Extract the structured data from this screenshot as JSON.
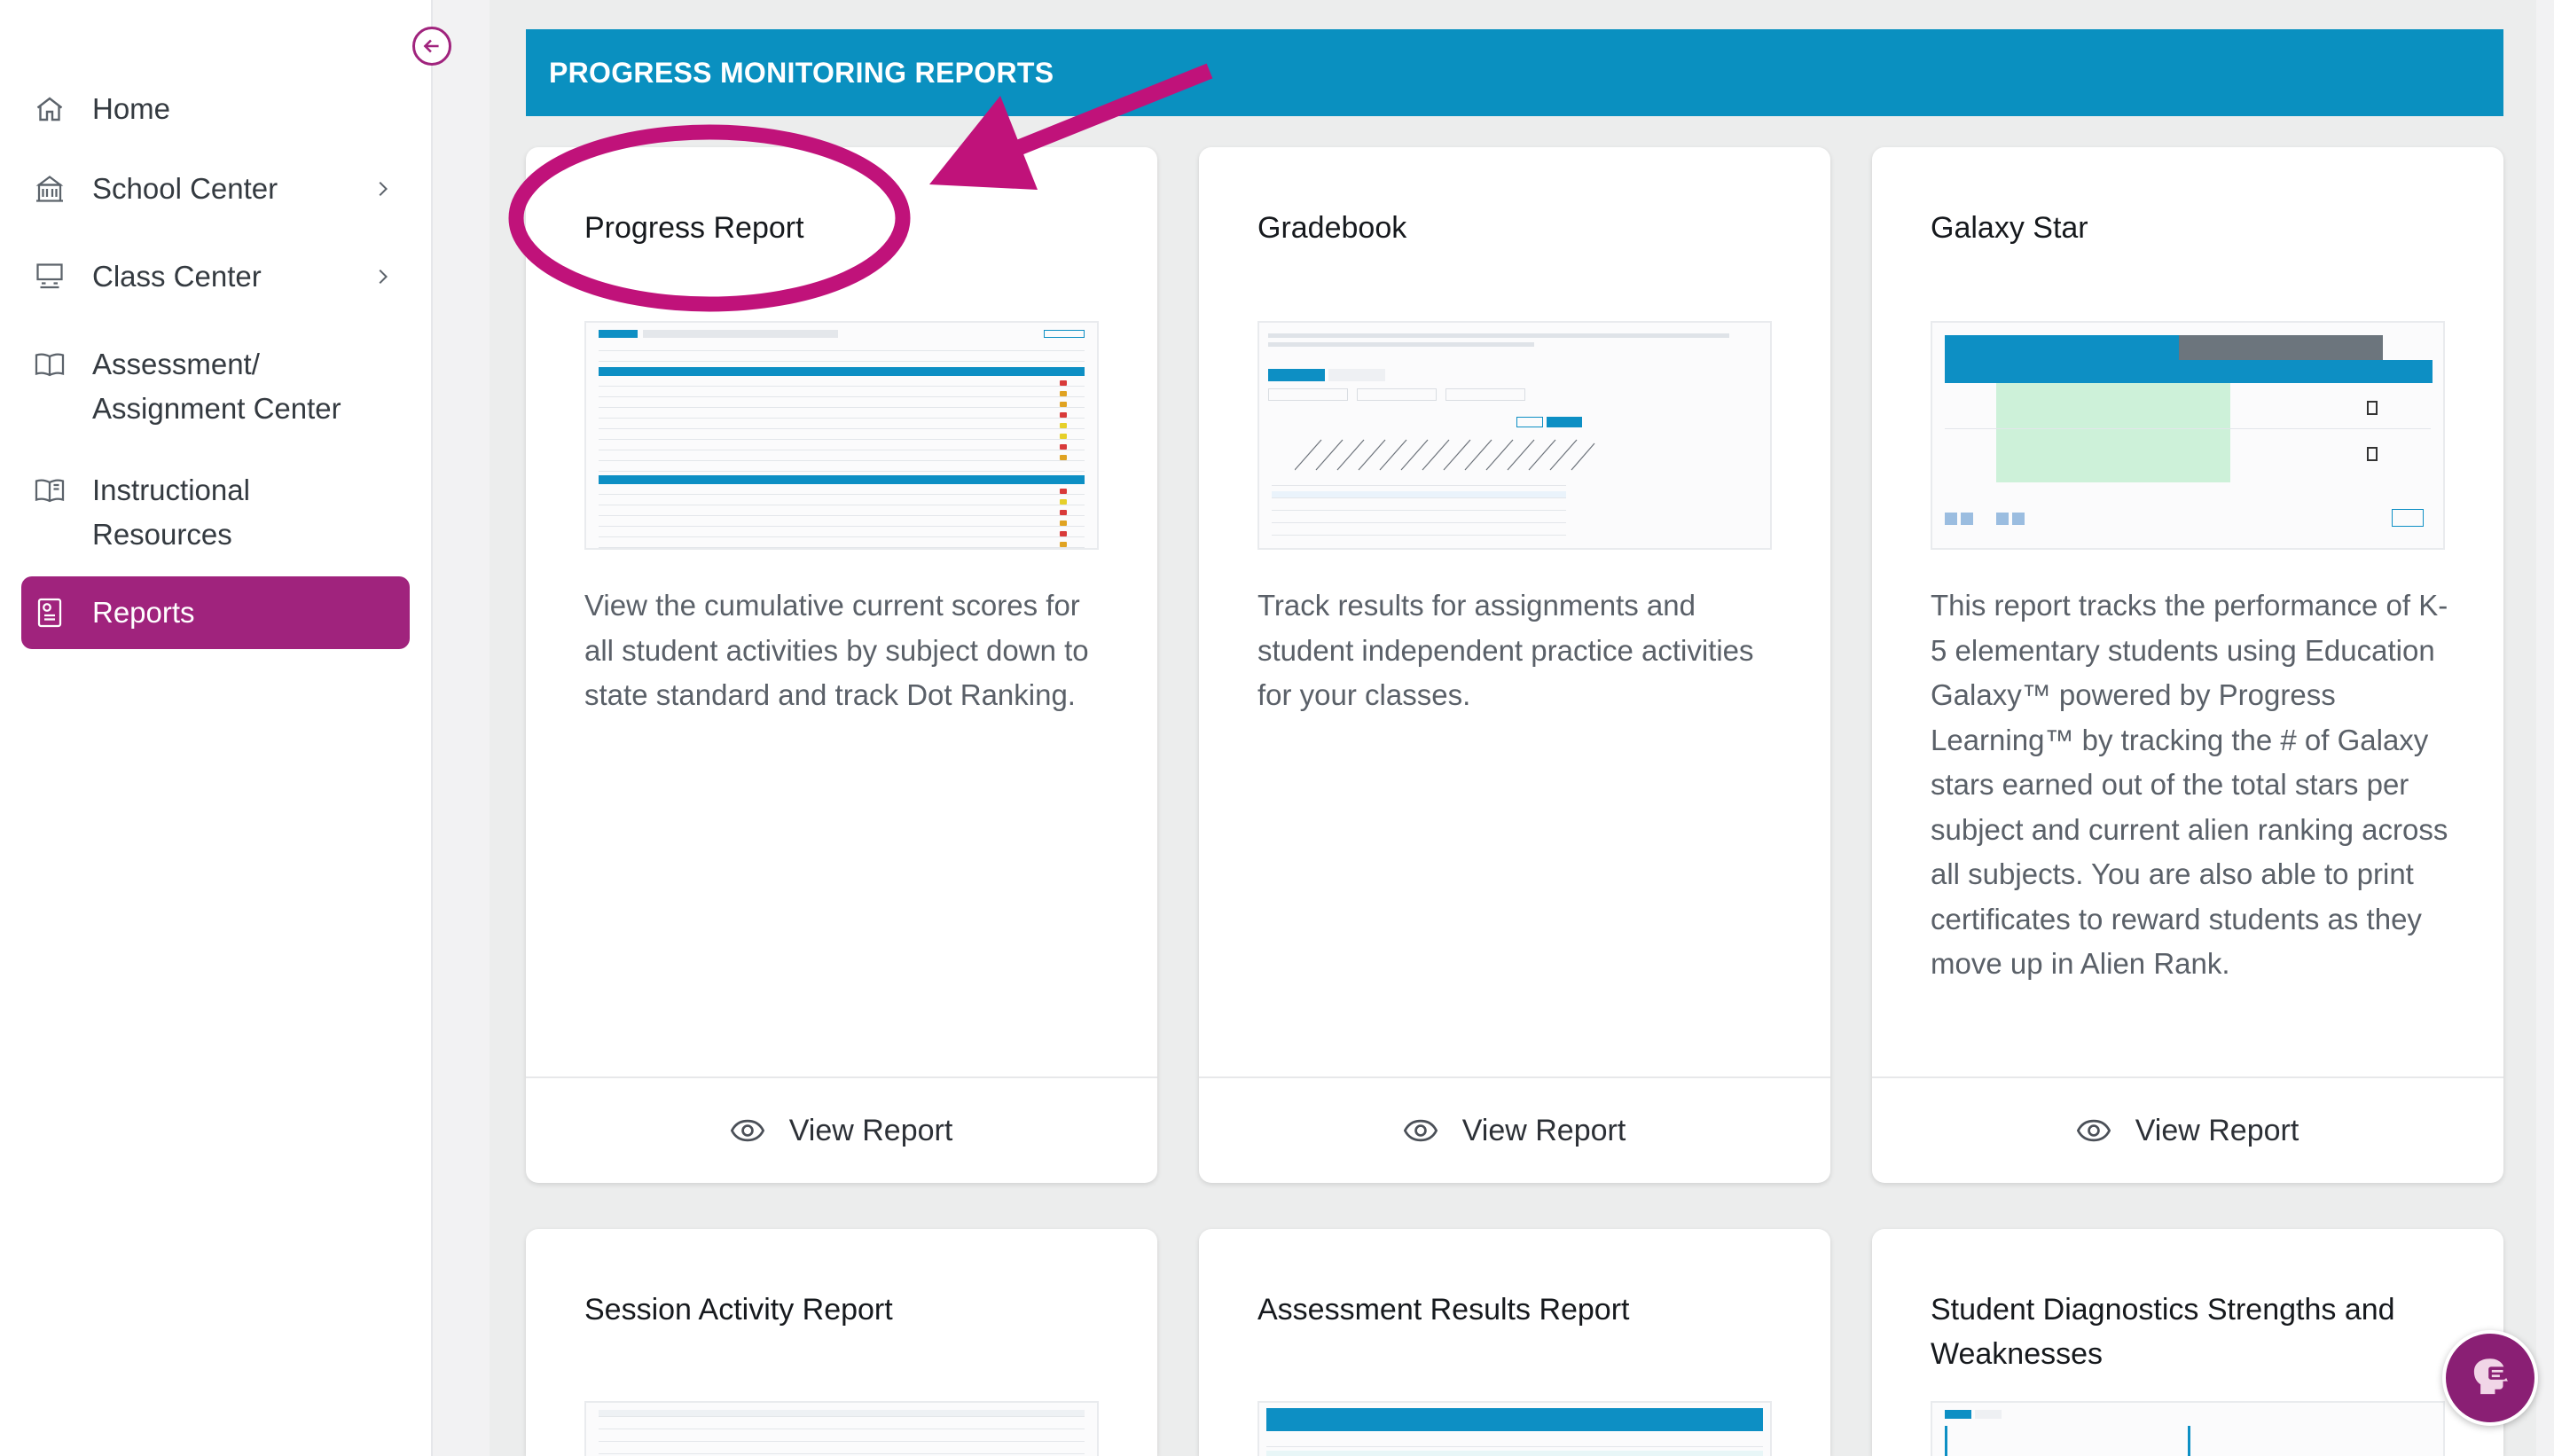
{
  "sidebar": {
    "items": [
      {
        "label": "Home",
        "icon": "home-icon"
      },
      {
        "label": "School Center",
        "icon": "school-icon"
      },
      {
        "label": "Class Center",
        "icon": "classroom-icon"
      },
      {
        "label": "Assessment/\nAssignment Center",
        "icon": "book-open-icon"
      },
      {
        "label": "Instructional\nResources",
        "icon": "book-resources-icon"
      },
      {
        "label": "Reports",
        "icon": "report-icon"
      }
    ]
  },
  "main": {
    "banner_title": "PROGRESS MONITORING REPORTS",
    "cards": [
      {
        "title": "Progress Report",
        "description": "View the cumulative current scores for all student activities by subject down to state standard and track Dot Ranking.",
        "button": "View Report"
      },
      {
        "title": "Gradebook",
        "description": "Track results for assignments and student independent practice activities for your classes.",
        "button": "View Report"
      },
      {
        "title": "Galaxy Star",
        "description": "This report tracks the performance of K-5 elementary students using Education Galaxy™ powered by Progress Learning™ by tracking the # of Galaxy stars earned out of the total stars per subject and current alien ranking across all subjects. You are also able to print certificates to reward students as they move up in Alien Rank.",
        "button": "View Report"
      },
      {
        "title": "Session Activity Report"
      },
      {
        "title": "Assessment Results Report"
      },
      {
        "title": "Student Diagnostics Strengths and Weaknesses"
      }
    ]
  },
  "colors": {
    "brand": "#a0237d",
    "banner": "#0a90c0",
    "annotation": "#c0127a"
  }
}
